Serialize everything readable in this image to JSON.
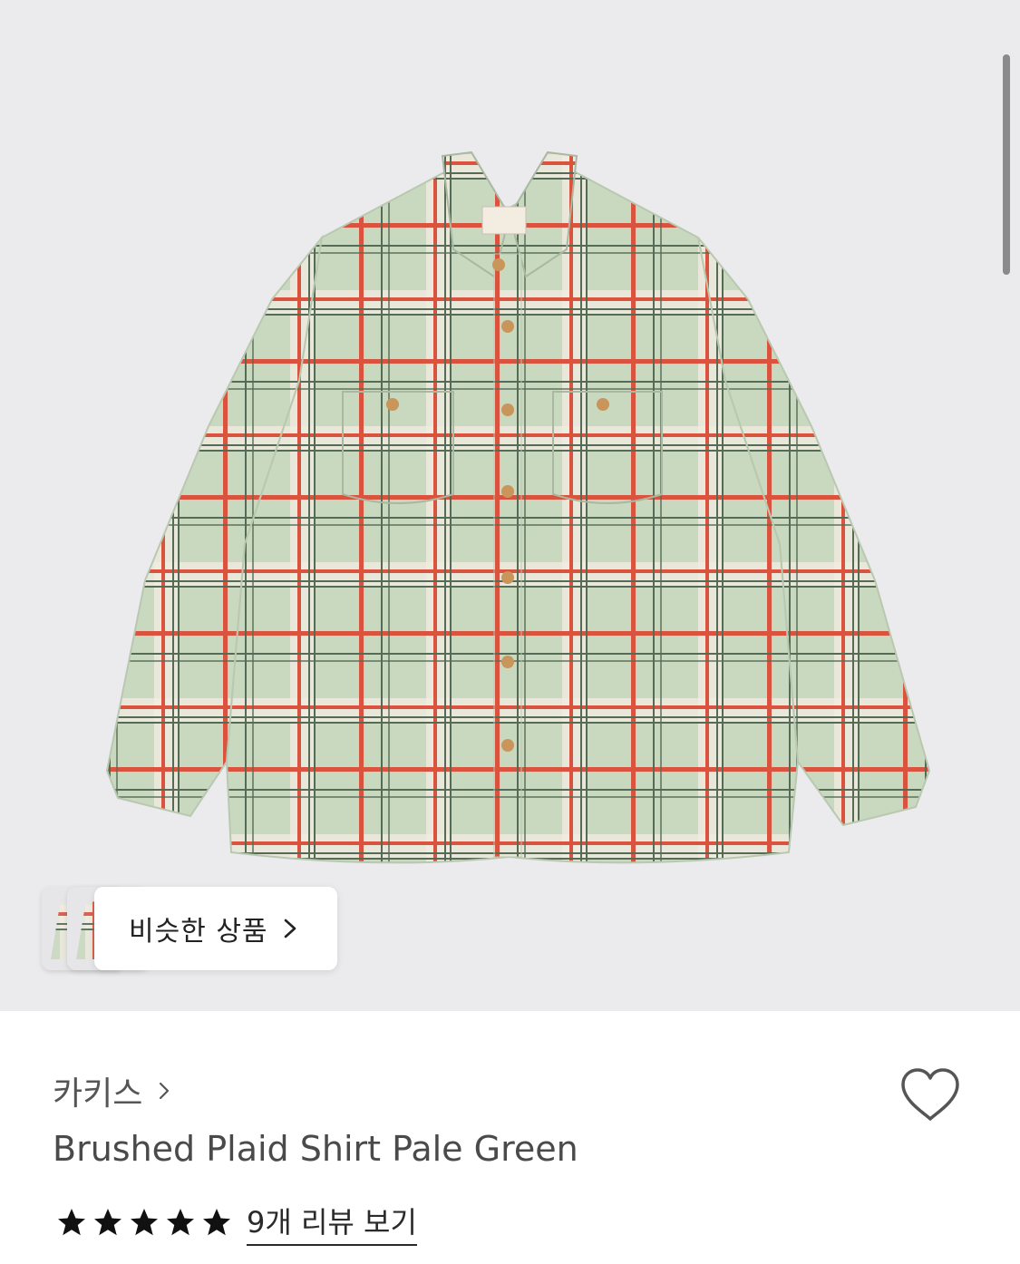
{
  "similar_products": {
    "label": "비슷한 상품"
  },
  "product": {
    "brand": "카키스",
    "title": "Brushed Plaid Shirt Pale Green",
    "rating_stars": 5,
    "review_link": "9개 리뷰 보기"
  },
  "colors": {
    "shirt_base": "#c9d9c0",
    "plaid_red": "#d9533f",
    "plaid_green": "#556b55",
    "plaid_cream": "#f3ece1",
    "button": "#c9955a"
  },
  "icons": {
    "heart": "heart-outline-icon",
    "star": "star-filled-icon",
    "chevron": "chevron-right-icon"
  }
}
